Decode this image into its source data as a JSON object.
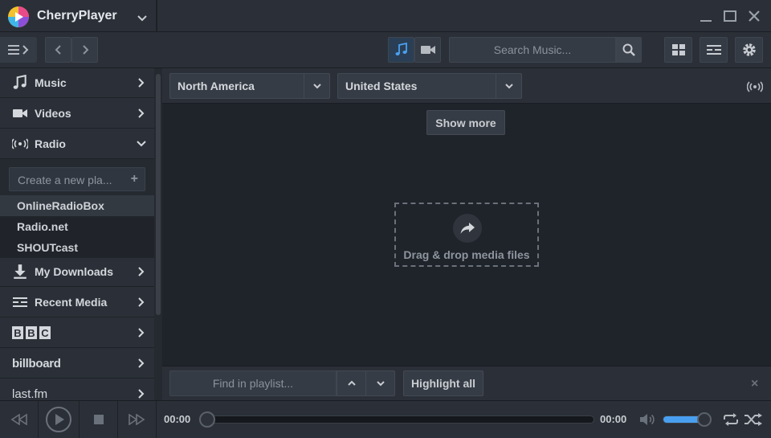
{
  "app": {
    "title": "CherryPlayer"
  },
  "toolbar": {
    "search_placeholder": "Search Music...",
    "accent_color": "#4aa0f0"
  },
  "sidebar": {
    "items": [
      {
        "label": "Music",
        "icon": "music-note-icon",
        "expanded": false
      },
      {
        "label": "Videos",
        "icon": "video-camera-icon",
        "expanded": false
      },
      {
        "label": "Radio",
        "icon": "broadcast-icon",
        "expanded": true
      },
      {
        "label": "My Downloads",
        "icon": "download-icon",
        "expanded": false
      },
      {
        "label": "Recent Media",
        "icon": "recent-media-icon",
        "expanded": false
      },
      {
        "label": "BBC",
        "icon": "bbc-logo",
        "expanded": false
      },
      {
        "label": "billboard",
        "icon": "billboard-logo",
        "expanded": false
      },
      {
        "label": "last.fm",
        "icon": "lastfm-logo",
        "expanded": false
      }
    ],
    "radio": {
      "new_playlist_placeholder": "Create a new pla...",
      "sources": [
        "OnlineRadioBox",
        "Radio.net",
        "SHOUTcast"
      ],
      "active_source": "OnlineRadioBox"
    }
  },
  "main": {
    "region_select": "North America",
    "country_select": "United States",
    "show_more_label": "Show more",
    "drop_label": "Drag & drop media files"
  },
  "findbar": {
    "placeholder": "Find in playlist...",
    "highlight_label": "Highlight all"
  },
  "player": {
    "time_elapsed": "00:00",
    "time_total": "00:00",
    "progress": 0,
    "volume": 0.9
  }
}
